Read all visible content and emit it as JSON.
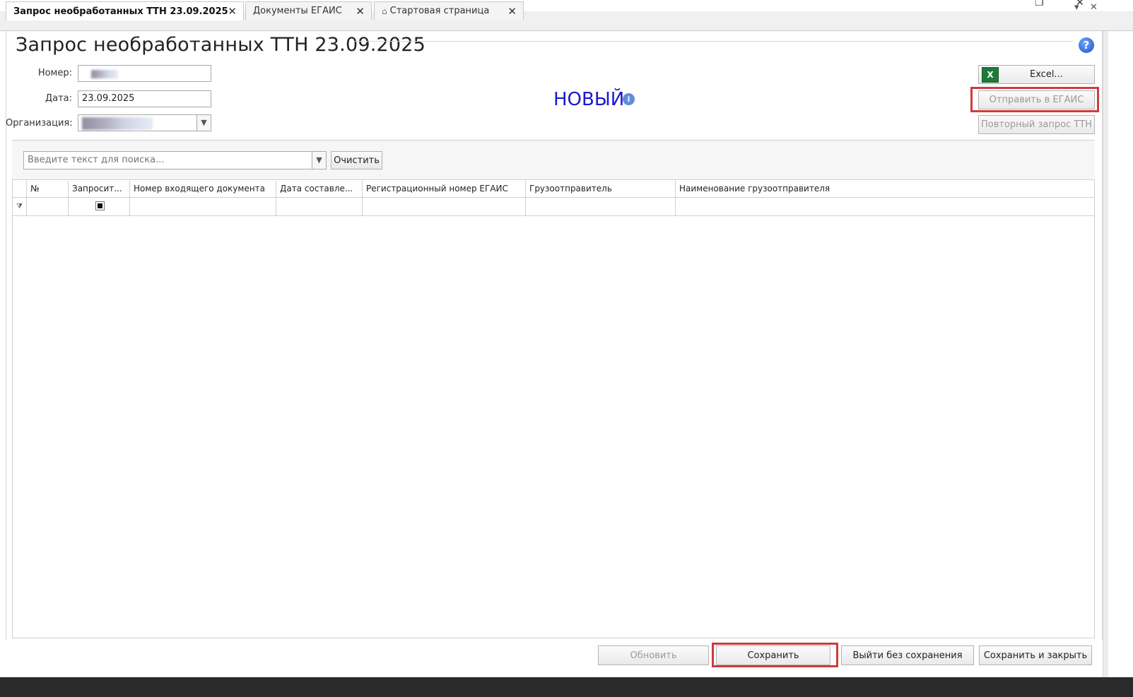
{
  "window": {
    "restore_glyph": "❐",
    "close_glyph": "✕"
  },
  "tabs": [
    {
      "label": "Запрос необработанных ТТН 23.09.2025",
      "active": true
    },
    {
      "label": "Документы ЕГАИС",
      "active": false
    },
    {
      "label": "Стартовая страница",
      "active": false,
      "icon": "home-icon"
    }
  ],
  "tabstrip_controls": {
    "dropdown_glyph": "▾",
    "close_glyph": "✕"
  },
  "page": {
    "title": "Запрос необработанных ТТН 23.09.2025",
    "help_glyph": "?"
  },
  "form": {
    "number_label": "Номер:",
    "number_value": "",
    "date_label": "Дата:",
    "date_value": "23.09.2025",
    "org_label": "Организация:",
    "org_value": ""
  },
  "status": {
    "text": "НОВЫЙ",
    "info_glyph": "i"
  },
  "actions": {
    "excel": "Excel...",
    "send_egais": "Отправить в ЕГАИС",
    "repeat_request": "Повторный запрос ТТН"
  },
  "search": {
    "placeholder": "Введите текст для поиска...",
    "clear": "Очистить"
  },
  "grid": {
    "columns": [
      "№",
      "Запросит...",
      "Номер входящего документа",
      "Дата составле...",
      "Регистрационный номер ЕГАИС",
      "Грузоотправитель",
      "Наименование грузоотправителя"
    ],
    "filter_glyph": "⧩",
    "rows": []
  },
  "footer": {
    "refresh": "Обновить",
    "save": "Сохранить",
    "exit_no_save": "Выйти без сохранения",
    "save_close": "Сохранить и закрыть"
  },
  "highlight_color": "#d03b3b",
  "status_color": "#1a1ad0"
}
